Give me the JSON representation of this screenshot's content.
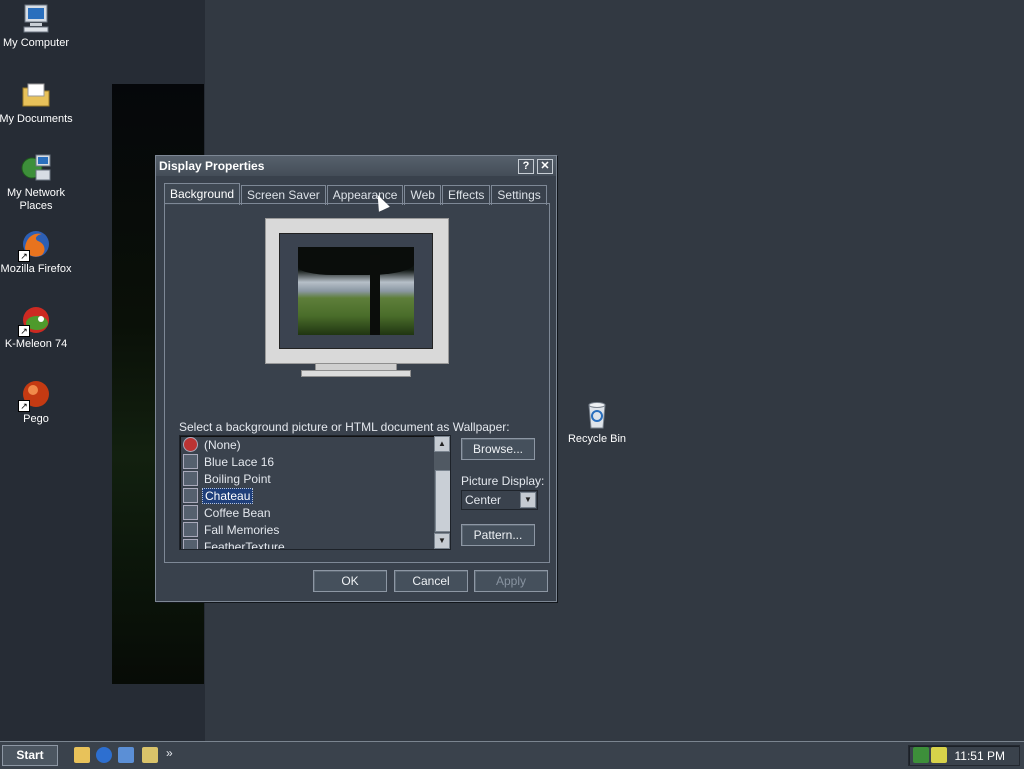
{
  "desktop": {
    "icons": [
      {
        "label": "My Computer",
        "icon": "computer-icon"
      },
      {
        "label": "My Documents",
        "icon": "folder-icon"
      },
      {
        "label": "My Network Places",
        "icon": "network-icon"
      },
      {
        "label": "Mozilla Firefox",
        "icon": "firefox-icon"
      },
      {
        "label": "K-Meleon 74",
        "icon": "kmeleon-icon"
      },
      {
        "label": "Pego",
        "icon": "pego-icon"
      },
      {
        "label": "Recycle Bin",
        "icon": "recycle-bin-icon"
      }
    ]
  },
  "dialog": {
    "title": "Display Properties",
    "help_glyph": "?",
    "close_glyph": "✕",
    "tabs": [
      "Background",
      "Screen Saver",
      "Appearance",
      "Web",
      "Effects",
      "Settings"
    ],
    "active_tab": "Background",
    "caption": "Select a background picture or HTML document as Wallpaper:",
    "wallpapers": [
      "(None)",
      "Blue Lace 16",
      "Boiling Point",
      "Chateau",
      "Coffee Bean",
      "Fall Memories",
      "FeatherTexture"
    ],
    "selected_wallpaper": "Chateau",
    "browse_label": "Browse...",
    "picture_display_label": "Picture Display:",
    "picture_display_value": "Center",
    "pattern_label": "Pattern...",
    "ok_label": "OK",
    "cancel_label": "Cancel",
    "apply_label": "Apply"
  },
  "taskbar": {
    "start_label": "Start",
    "overflow_glyph": "»",
    "clock": "11:51 PM"
  }
}
